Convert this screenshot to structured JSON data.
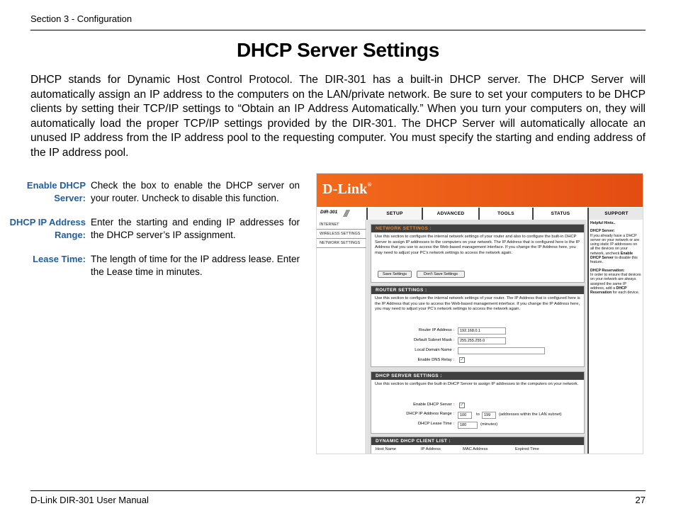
{
  "header": {
    "section": "Section 3 - Configuration"
  },
  "title": "DHCP Server Settings",
  "intro": "DHCP stands for Dynamic Host Control Protocol. The DIR-301 has a built-in DHCP server. The DHCP Server will automatically assign an IP address to the computers on the LAN/private network. Be sure to set your computers to be DHCP clients by setting their TCP/IP settings to “Obtain an IP Address Automatically.”  When you turn your computers on, they will automatically load the proper TCP/IP settings provided by the DIR-301. The DHCP Server will automatically allocate an unused IP address from the IP address pool to the requesting computer. You must specify the starting and ending address of the IP address pool.",
  "definitions": [
    {
      "term_line1": "Enable DHCP",
      "term_line2": "Server:",
      "desc": "Check the box to enable the DHCP server on your router. Uncheck to disable this function."
    },
    {
      "term_line1": "DHCP IP Address",
      "term_line2": "Range:",
      "desc": "Enter the starting and ending IP addresses for the DHCP server’s IP assignment."
    },
    {
      "term_line1": "Lease Time:",
      "term_line2": "",
      "desc": "The length of time for the IP address lease. Enter the Lease time in minutes."
    }
  ],
  "footer": {
    "manual": "D-Link DIR-301 User Manual",
    "page": "27"
  },
  "router_ui": {
    "logo": "D-Link",
    "model": "DIR-301",
    "tabs": [
      "SETUP",
      "ADVANCED",
      "TOOLS",
      "STATUS",
      "SUPPORT"
    ],
    "left_nav": [
      "INTERNET",
      "WIRELESS SETTINGS",
      "NETWORK SETTINGS"
    ],
    "network_settings": {
      "heading": "NETWORK SETTINGS :",
      "text": "Use this section to configure the internal network settings of your router and also to configure the built-in DHCP Server to assign IP addresses to the computers on your network. The IP Address that is configured here is the IP Address that you use to access the Web-based management interface. If you change the IP Address here, you may need to adjust your PC's network settings to access the network again.",
      "save_button": "Save Settings",
      "dont_save_button": "Don't Save Settings"
    },
    "router_settings": {
      "heading": "ROUTER SETTINGS :",
      "text": "Use this section to configure the internal network settings of your router. The IP Address that is configured here is the IP Address that you use to access the Web-based management interface. If you change the IP Address here, you may need to adjust your PC's network settings to access the network again.",
      "ip_label": "Router IP Address :",
      "ip_value": "192.168.0.1",
      "mask_label": "Default Subnet Mask :",
      "mask_value": "255.255.255.0",
      "domain_label": "Local Domain Name :",
      "domain_value": "",
      "dns_label": "Enable DNS Relay :"
    },
    "dhcp_settings": {
      "heading": "DHCP SERVER SETTINGS :",
      "text": "Use this section to configure the built-in DHCP Server to assign IP addresses to the computers on your network.",
      "enable_label": "Enable DHCP Server :",
      "range_label": "DHCP IP Address Range :",
      "range_start": "100",
      "range_to": "to",
      "range_end": "199",
      "range_note": "(addresses within the LAN subnet)",
      "lease_label": "DHCP Lease Time :",
      "lease_value": "180",
      "lease_unit": "(minutes)"
    },
    "client_list": {
      "heading": "DYNAMIC DHCP CLIENT LIST :",
      "columns": [
        "Host Name",
        "IP Address",
        "MAC Address",
        "Expired Time"
      ]
    },
    "help": {
      "title": "Helpful Hints..",
      "h1": "DHCP Server:",
      "p1a": "If you already have a DHCP server on your network or are using static IP addresses on all the devices on your network, uncheck ",
      "p1b": "Enable DHCP Server",
      "p1c": " to disable this feature.",
      "h2": "DHCP Reservation:",
      "p2a": "In order to ensure that devices on your network are always assigned the same IP address, add a ",
      "p2b": "DHCP Reservation",
      "p2c": " for each device."
    }
  }
}
